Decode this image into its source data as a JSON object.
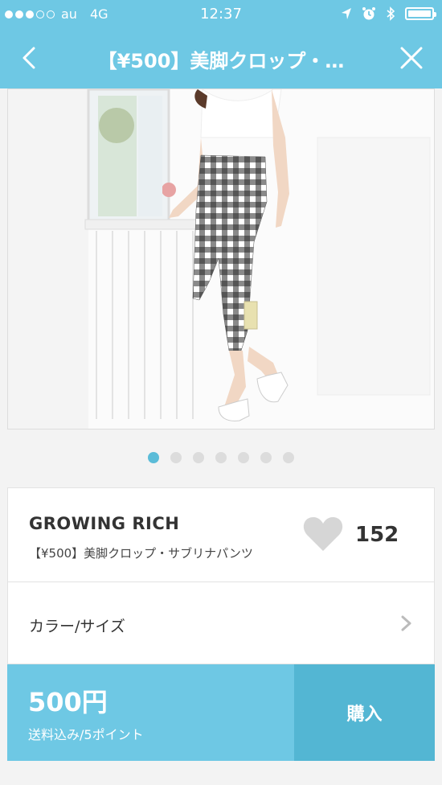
{
  "status_bar": {
    "carrier": "au",
    "network": "4G",
    "time": "12:37",
    "signal_dots_filled": 3,
    "signal_dots_total": 5,
    "icons": [
      "location-arrow-icon",
      "alarm-icon",
      "bluetooth-icon",
      "battery-icon"
    ]
  },
  "nav": {
    "title": "【¥500】美脚クロップ・…",
    "back_icon": "chevron-left-icon",
    "close_icon": "close-icon"
  },
  "gallery": {
    "slide_count": 7,
    "active_index": 0
  },
  "product": {
    "brand": "GROWING RICH",
    "name": "【¥500】美脚クロップ・サブリナパンツ",
    "likes": "152"
  },
  "options": {
    "label": "カラー/サイズ"
  },
  "purchase": {
    "price": "500円",
    "shipping": "送料込み/5ポイント",
    "buy_label": "購入"
  },
  "colors": {
    "accent": "#6ec8e4",
    "buy": "#53b6d3",
    "pager_active": "#5bbcd8"
  }
}
